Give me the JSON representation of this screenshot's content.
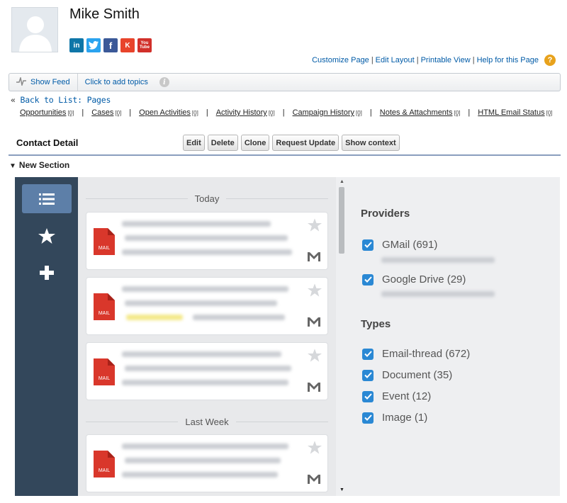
{
  "contact": {
    "name": "Mike Smith"
  },
  "social": {
    "linkedin": "in",
    "twitter": "t",
    "facebook": "f",
    "klout": "K",
    "youtube_top": "You",
    "youtube_bottom": "Tube"
  },
  "top_links": [
    "Customize Page",
    "Edit Layout",
    "Printable View",
    "Help for this Page"
  ],
  "top_links_sep": "|",
  "help_icon": "?",
  "feed_bar": {
    "show_feed": "Show Feed",
    "add_topics": "Click to add topics",
    "info_icon": "i"
  },
  "back_link": {
    "prefix": "«",
    "label": "Back to List: Pages"
  },
  "related_lists": [
    {
      "label": "Opportunities",
      "count": "[0]"
    },
    {
      "label": "Cases",
      "count": "[0]"
    },
    {
      "label": "Open Activities",
      "count": "[0]"
    },
    {
      "label": "Activity History",
      "count": "[0]"
    },
    {
      "label": "Campaign History",
      "count": "[0]"
    },
    {
      "label": "Notes & Attachments",
      "count": "[0]"
    },
    {
      "label": "HTML Email Status",
      "count": "[0]"
    }
  ],
  "related_sep": "|",
  "detail": {
    "title": "Contact Detail",
    "buttons": [
      "Edit",
      "Delete",
      "Clone",
      "Request Update",
      "Show context"
    ]
  },
  "section": {
    "toggle": "▼",
    "title": "New Section"
  },
  "feed": {
    "groups": [
      {
        "label": "Today"
      },
      {
        "label": "Last Week"
      }
    ],
    "mail_label": "MAIL"
  },
  "filters": {
    "providers_title": "Providers",
    "providers": [
      {
        "label": "GMail (691)",
        "checked": true
      },
      {
        "label": "Google Drive (29)",
        "checked": true
      }
    ],
    "types_title": "Types",
    "types": [
      {
        "label": "Email-thread (672)",
        "checked": true
      },
      {
        "label": "Document (35)",
        "checked": true
      },
      {
        "label": "Event (12)",
        "checked": true
      },
      {
        "label": "Image (1)",
        "checked": true
      }
    ]
  },
  "colors": {
    "nav_bg": "#33475b",
    "nav_active": "#5d7fa8",
    "link": "#015ba7",
    "checkbox": "#2a88d4",
    "mail_red": "#d9372b"
  }
}
